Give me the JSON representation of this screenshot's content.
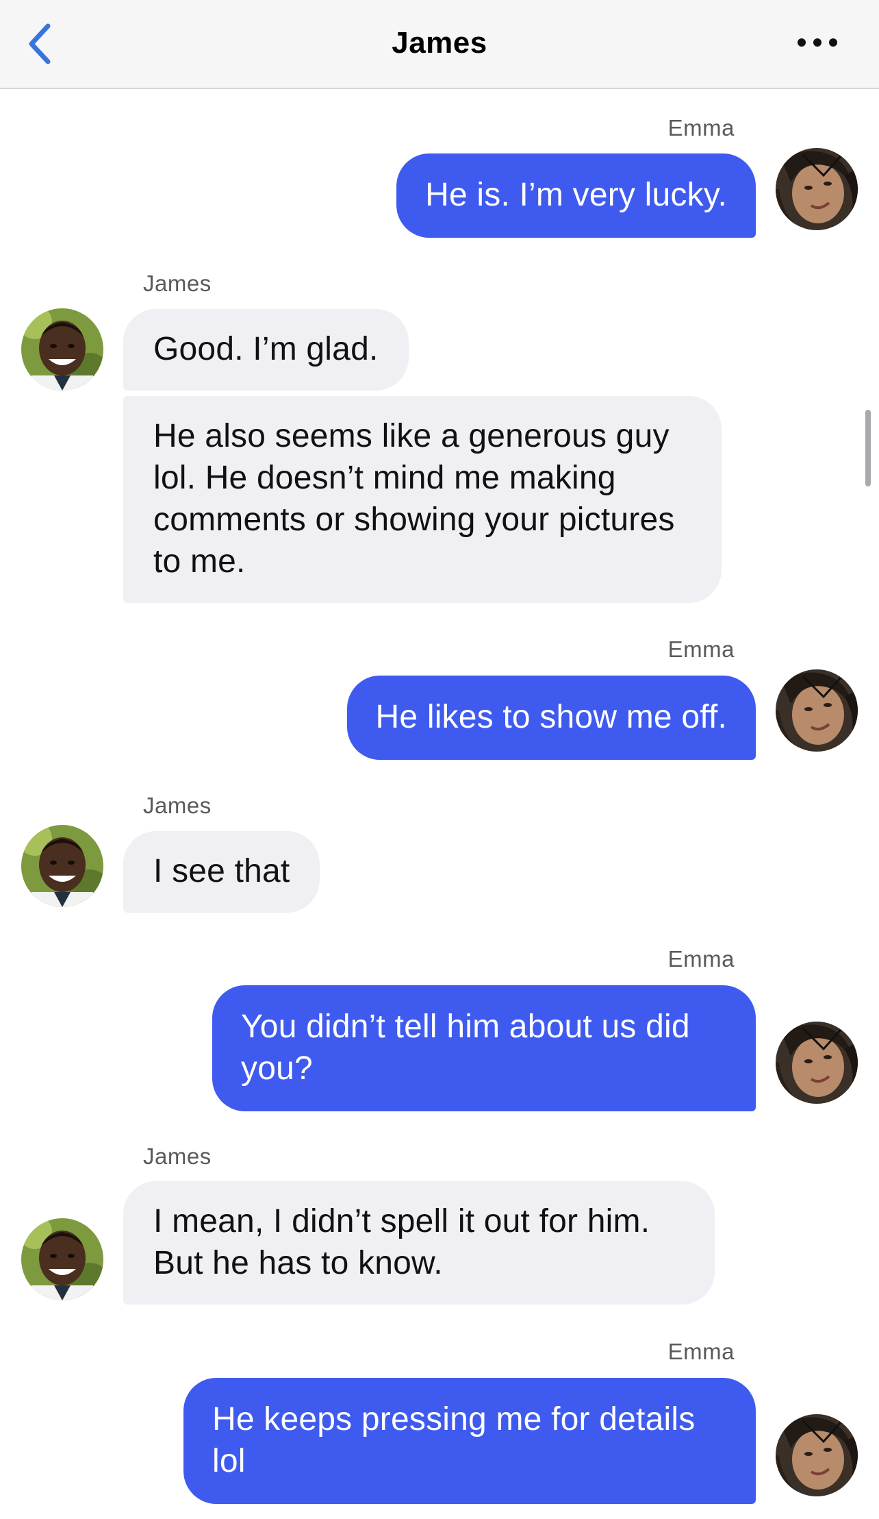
{
  "header": {
    "title": "James",
    "back_icon": "chevron-left-icon",
    "more_icon": "ellipsis-icon",
    "accent": "#3a74d8"
  },
  "colors": {
    "outgoing_bubble": "#3f5bef",
    "incoming_bubble": "#efeff4"
  },
  "messages": [
    {
      "sender": "Emma",
      "direction": "outgoing",
      "text": "He is. I’m very lucky."
    },
    {
      "sender": "James",
      "direction": "incoming",
      "text": "Good. I’m glad."
    },
    {
      "sender": "James",
      "direction": "incoming",
      "text": "He also seems like a generous guy lol. He doesn’t mind me making comments or showing your pictures to me."
    },
    {
      "sender": "Emma",
      "direction": "outgoing",
      "text": "He likes to show me off."
    },
    {
      "sender": "James",
      "direction": "incoming",
      "text": "I see that"
    },
    {
      "sender": "Emma",
      "direction": "outgoing",
      "text": "You didn’t tell him about us did you?"
    },
    {
      "sender": "James",
      "direction": "incoming",
      "text": "I mean, I didn’t spell it out for him. But he has to know."
    },
    {
      "sender": "Emma",
      "direction": "outgoing",
      "text": "He keeps pressing me for details lol"
    }
  ]
}
